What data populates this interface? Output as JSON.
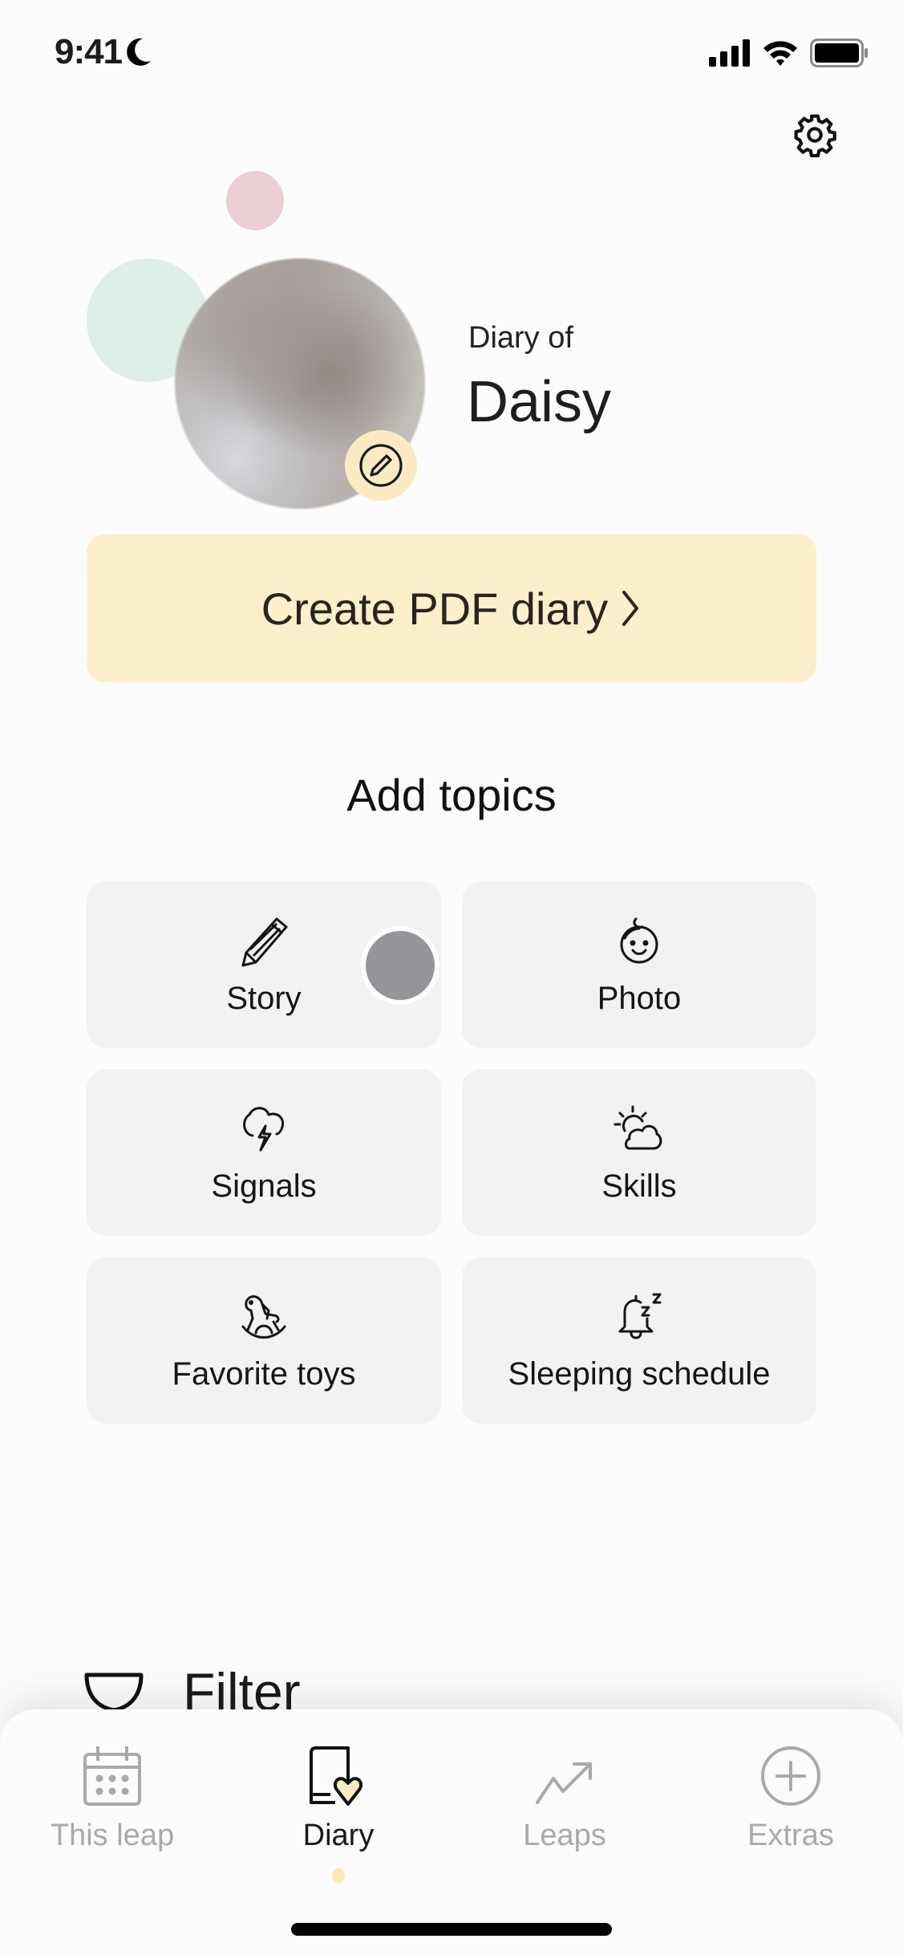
{
  "status_bar": {
    "time": "9:41",
    "icons": [
      "moon-icon",
      "cellular-signal-icon",
      "wifi-icon",
      "battery-icon"
    ]
  },
  "header": {
    "settings_icon": "gear-icon"
  },
  "profile": {
    "subtitle": "Diary of",
    "name": "Daisy",
    "edit_icon": "pencil-circle-icon"
  },
  "pdf_button": {
    "label": "Create PDF diary",
    "chevron": "›"
  },
  "topics": {
    "title": "Add topics",
    "items": [
      {
        "label": "Story",
        "icon": "pencil-icon"
      },
      {
        "label": "Photo",
        "icon": "baby-face-icon"
      },
      {
        "label": "Signals",
        "icon": "storm-cloud-icon"
      },
      {
        "label": "Skills",
        "icon": "sun-cloud-icon"
      },
      {
        "label": "Favorite toys",
        "icon": "rocking-horse-icon"
      },
      {
        "label": "Sleeping schedule",
        "icon": "bell-sleep-icon"
      }
    ]
  },
  "filter": {
    "label": "Filter",
    "icon": "filter-funnel-icon"
  },
  "tab_bar": {
    "active_index": 1,
    "tabs": [
      {
        "label": "This leap",
        "icon": "calendar-icon"
      },
      {
        "label": "Diary",
        "icon": "diary-heart-icon"
      },
      {
        "label": "Leaps",
        "icon": "trending-up-icon"
      },
      {
        "label": "Extras",
        "icon": "plus-circle-icon"
      }
    ]
  },
  "colors": {
    "accent_yellow": "#fdefcc",
    "tile_background": "#f3f1f4",
    "inactive_tab": "#a9a9a9",
    "active_tab": "#1a1a1a",
    "bubble_pink": "#ebcfd3",
    "bubble_green": "#e0eee8"
  }
}
